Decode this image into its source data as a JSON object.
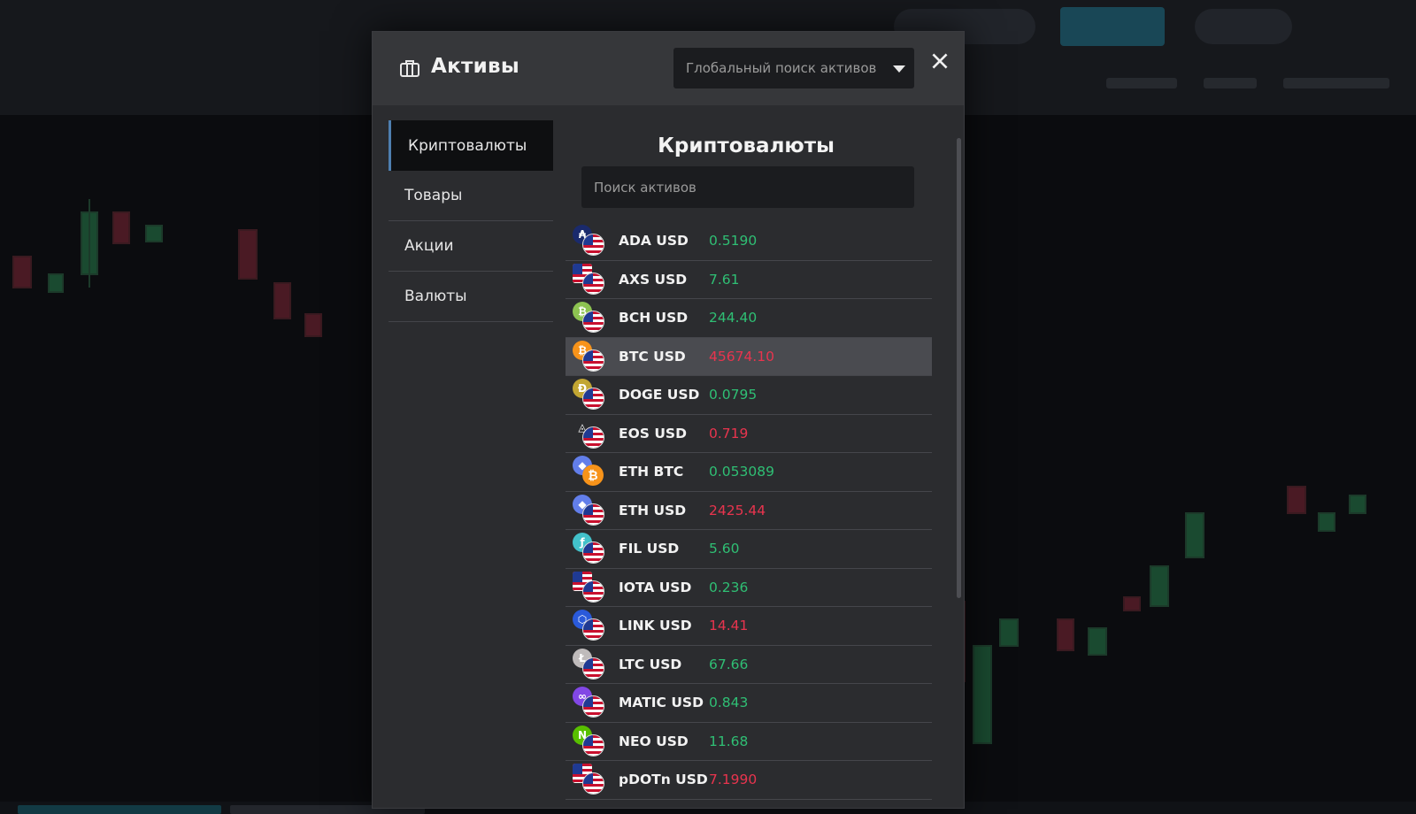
{
  "modal": {
    "title": "Активы",
    "global_search_placeholder": "Глобальный поиск активов",
    "close_label": "✕"
  },
  "sidebar": {
    "items": [
      {
        "label": "Криптовалюты",
        "active": true
      },
      {
        "label": "Товары",
        "active": false
      },
      {
        "label": "Акции",
        "active": false
      },
      {
        "label": "Валюты",
        "active": false
      }
    ]
  },
  "main": {
    "title": "Криптовалюты",
    "search_placeholder": "Поиск активов"
  },
  "colors": {
    "price_up": "#2fbf74",
    "price_down": "#e8344e",
    "accent": "#4e7fb0"
  },
  "assets": [
    {
      "name": "ADA USD",
      "price": "0.5190",
      "trend": "up",
      "coin_color": "#1a2a6c",
      "coin_glyph": "₳",
      "quote": "usd-flag-icon"
    },
    {
      "name": "AXS USD",
      "price": "7.61",
      "trend": "up",
      "coin_color": "#c0392b",
      "coin_glyph": "",
      "quote": "usd-flag-icon"
    },
    {
      "name": "BCH USD",
      "price": "244.40",
      "trend": "up",
      "coin_color": "#8dc351",
      "coin_glyph": "₿",
      "quote": "usd-flag-icon"
    },
    {
      "name": "BTC USD",
      "price": "45674.10",
      "trend": "down",
      "coin_color": "#f7931a",
      "coin_glyph": "₿",
      "quote": "usd-flag-icon",
      "highlight": true
    },
    {
      "name": "DOGE USD",
      "price": "0.0795",
      "trend": "up",
      "coin_color": "#c2a633",
      "coin_glyph": "Ð",
      "quote": "usd-flag-icon"
    },
    {
      "name": "EOS USD",
      "price": "0.719",
      "trend": "down",
      "coin_color": "#2b2c2f",
      "coin_glyph": "◬",
      "quote": "usd-flag-icon"
    },
    {
      "name": "ETH BTC",
      "price": "0.053089",
      "trend": "up",
      "coin_color": "#627eea",
      "coin_glyph": "◆",
      "quote": "btc-coin-icon"
    },
    {
      "name": "ETH USD",
      "price": "2425.44",
      "trend": "down",
      "coin_color": "#627eea",
      "coin_glyph": "◆",
      "quote": "usd-flag-icon"
    },
    {
      "name": "FIL USD",
      "price": "5.60",
      "trend": "up",
      "coin_color": "#42c1ca",
      "coin_glyph": "ƒ",
      "quote": "usd-flag-icon"
    },
    {
      "name": "IOTA USD",
      "price": "0.236",
      "trend": "up",
      "coin_color": "#c0392b",
      "coin_glyph": "",
      "quote": "usd-flag-icon"
    },
    {
      "name": "LINK USD",
      "price": "14.41",
      "trend": "down",
      "coin_color": "#2a5ada",
      "coin_glyph": "⬡",
      "quote": "usd-flag-icon"
    },
    {
      "name": "LTC USD",
      "price": "67.66",
      "trend": "up",
      "coin_color": "#bfbbbb",
      "coin_glyph": "Ł",
      "quote": "usd-flag-icon"
    },
    {
      "name": "MATIC USD",
      "price": "0.843",
      "trend": "up",
      "coin_color": "#8247e5",
      "coin_glyph": "∞",
      "quote": "usd-flag-icon"
    },
    {
      "name": "NEO USD",
      "price": "11.68",
      "trend": "up",
      "coin_color": "#58bf00",
      "coin_glyph": "N",
      "quote": "usd-flag-icon"
    },
    {
      "name": "pDOTn USD",
      "price": "7.1990",
      "trend": "down",
      "coin_color": "#c0392b",
      "coin_glyph": "",
      "quote": "usd-flag-icon"
    }
  ]
}
